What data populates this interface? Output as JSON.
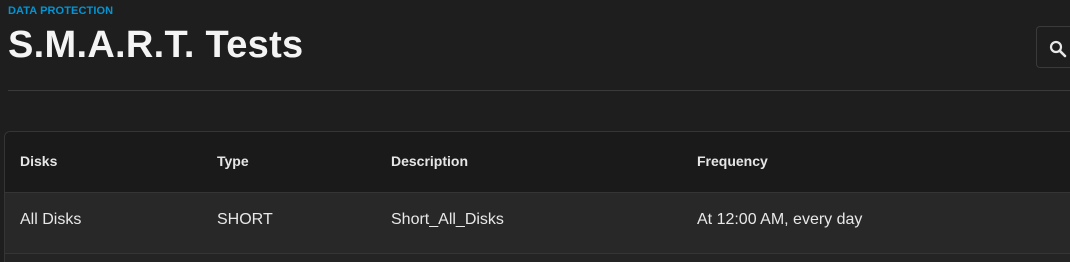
{
  "header": {
    "section_label": "DATA PROTECTION",
    "title": "S.M.A.R.T. Tests",
    "search_icon": "search-icon"
  },
  "table": {
    "columns": [
      "Disks",
      "Type",
      "Description",
      "Frequency"
    ],
    "rows": [
      {
        "disks": "All Disks",
        "type": "SHORT",
        "description": "Short_All_Disks",
        "frequency": "At 12:00 AM, every day"
      }
    ]
  },
  "colors": {
    "background": "#1e1e1e",
    "accent": "#0095d5",
    "table_header_bg": "#1a1a1a",
    "row_bg": "#282828"
  }
}
